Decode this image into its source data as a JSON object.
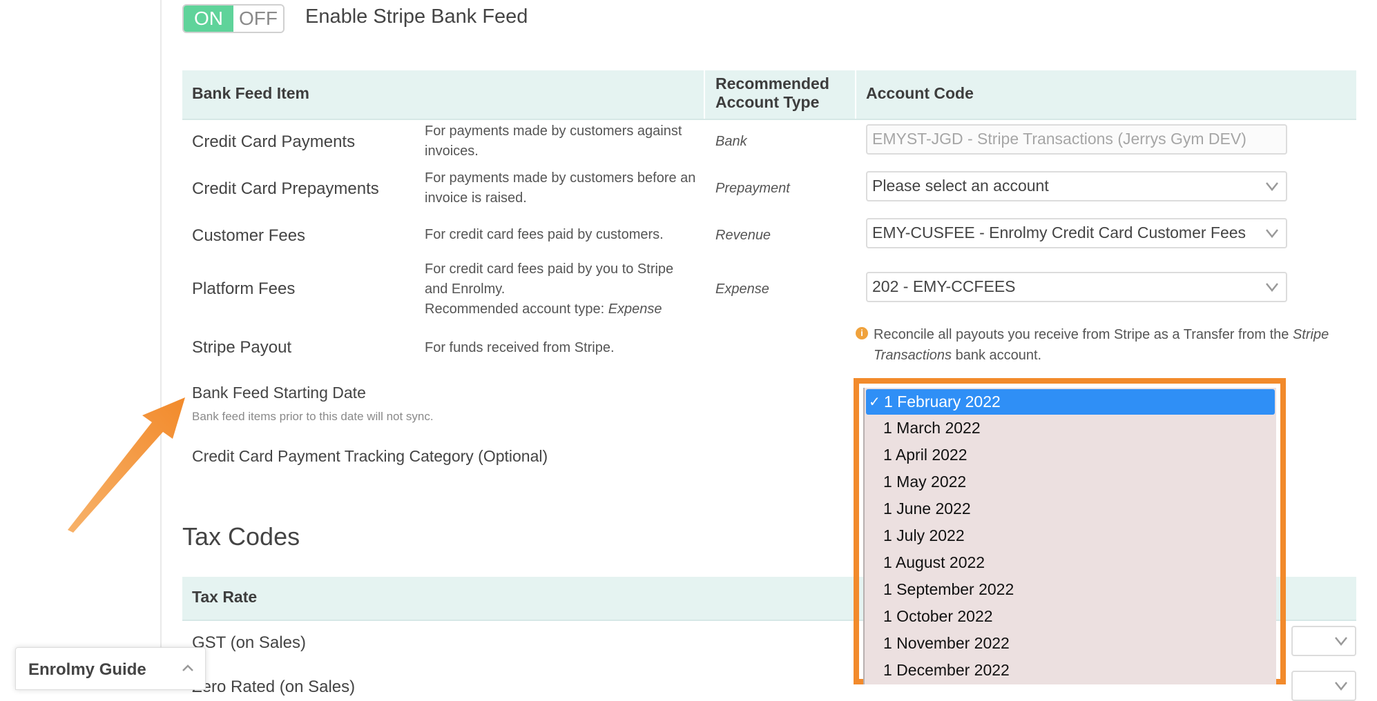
{
  "toggle": {
    "on_label": "ON",
    "off_label": "OFF",
    "label": "Enable Stripe Bank Feed"
  },
  "table": {
    "headers": {
      "item": "Bank Feed Item",
      "type_line1": "Recommended",
      "type_line2": "Account Type",
      "code": "Account Code"
    },
    "rows": [
      {
        "label": "Credit Card Payments",
        "desc_lines": [
          "For payments made by customers against",
          "invoices."
        ],
        "type": "Bank",
        "field": "EMYST-JGD - Stripe Transactions (Jerrys Gym DEV)"
      },
      {
        "label": "Credit Card Prepayments",
        "desc_lines": [
          "For payments made by customers before an",
          "invoice is raised."
        ],
        "type": "Prepayment",
        "field": "Please select an account"
      },
      {
        "label": "Customer Fees",
        "desc_lines": [
          "For credit card fees paid by customers."
        ],
        "type": "Revenue",
        "field": "EMY-CUSFEE - Enrolmy Credit Card Customer Fees"
      },
      {
        "label": "Platform Fees",
        "desc_lines": [
          "For credit card fees paid by you to Stripe",
          "and Enrolmy.",
          "Recommended account type: "
        ],
        "desc_italic": "Expense",
        "type": "Expense",
        "field": "202 - EMY-CCFEES"
      },
      {
        "label": "Stripe Payout",
        "desc_lines": [
          "For funds received from Stripe."
        ]
      }
    ]
  },
  "payout_info": {
    "icon": "info-icon",
    "text_a": "Reconcile all payouts you receive from Stripe as a ",
    "text_transfer": "Transfer",
    "text_b": " from the ",
    "text_italic": "Stripe Transactions",
    "text_c": " bank account."
  },
  "starting_date": {
    "label": "Bank Feed Starting Date",
    "hint": "Bank feed items prior to this date will not sync."
  },
  "tracking_category": {
    "label": "Credit Card Payment Tracking Category (Optional)"
  },
  "tax": {
    "title": "Tax Codes",
    "header": "Tax Rate",
    "rows": [
      "GST (on Sales)",
      "Zero Rated (on Sales)"
    ]
  },
  "guide": {
    "label": "Enrolmy Guide"
  },
  "dropdown": {
    "selected_index": 0,
    "check": "✓",
    "options": [
      "1 February 2022",
      "1 March 2022",
      "1 April 2022",
      "1 May 2022",
      "1 June 2022",
      "1 July 2022",
      "1 August 2022",
      "1 September 2022",
      "1 October 2022",
      "1 November 2022",
      "1 December 2022"
    ]
  },
  "colors": {
    "accent_orange": "#f28a2b",
    "toggle_on": "#5fd39a",
    "header_bg": "#e5f3f1",
    "selected_blue": "#2f8ff6"
  }
}
